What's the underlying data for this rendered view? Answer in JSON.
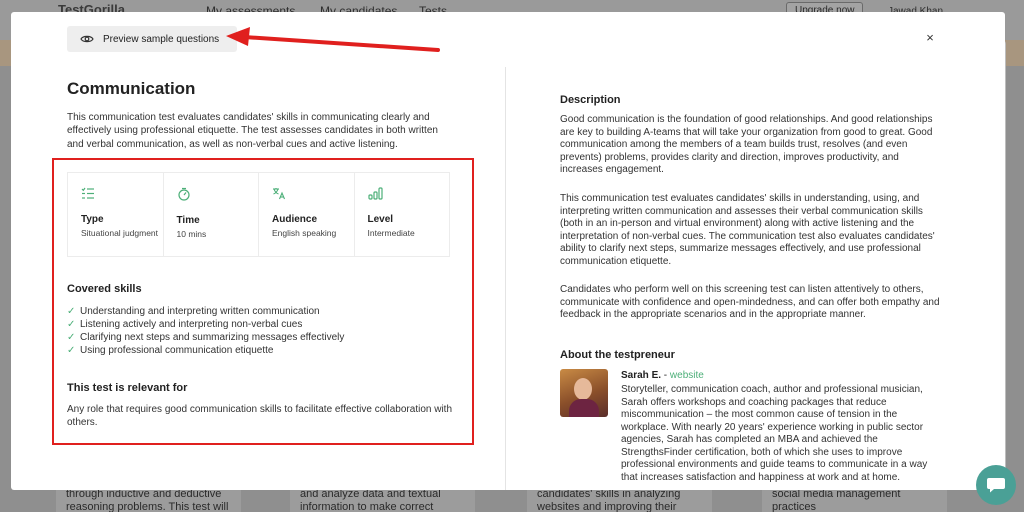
{
  "background": {
    "logo": "TestGorilla",
    "nav": [
      "My assessments",
      "My candidates",
      "Tests"
    ],
    "upgrade_label": "Upgrade now",
    "user_name": "Jawad Khan",
    "cards": [
      "through inductive and deductive\nreasoning problems. This test will",
      "and analyze data and textual\ninformation to make correct",
      "candidates' skills in analyzing\nwebsites and improving their ranking",
      "social media management practices\nand their ability to apply their"
    ]
  },
  "modal": {
    "preview_label": "Preview sample questions",
    "close_label": "×",
    "title": "Communication",
    "intro": "This communication test evaluates candidates' skills in communicating clearly and effectively using professional etiquette. The test assesses candidates in both written and verbal communication, as well as non-verbal cues and active listening.",
    "info": [
      {
        "icon": "list-icon",
        "label": "Type",
        "value": "Situational judgment"
      },
      {
        "icon": "stopwatch-icon",
        "label": "Time",
        "value": "10 mins"
      },
      {
        "icon": "translate-icon",
        "label": "Audience",
        "value": "English speaking"
      },
      {
        "icon": "bars-icon",
        "label": "Level",
        "value": "Intermediate"
      }
    ],
    "covered_skills_title": "Covered skills",
    "skills": [
      "Understanding and interpreting written communication",
      "Listening actively and interpreting non-verbal cues",
      "Clarifying next steps and summarizing messages effectively",
      "Using professional communication etiquette"
    ],
    "relevant_title": "This test is relevant for",
    "relevant_text": "Any role that requires good communication skills to facilitate effective collaboration with others.",
    "description_title": "Description",
    "description": [
      "Good communication is the foundation of good relationships. And good relationships are key to building A-teams that will take your organization from good to great. Good communication among the members of a team builds trust, resolves (and even prevents) problems, provides clarity and direction, improves productivity, and increases engagement.",
      "This communication test evaluates candidates' skills in understanding, using, and interpreting written communication and assesses their verbal communication skills (both in an in-person and virtual environment) along with active listening and the interpretation of non-verbal cues. The communication test also evaluates candidates' ability to clarify next steps, summarize messages effectively, and use professional communication etiquette.",
      "Candidates who perform well on this screening test can listen attentively to others, communicate with confidence and open-mindedness, and can offer both empathy and feedback in the appropriate scenarios and in the appropriate manner."
    ],
    "testpreneur_title": "About the testpreneur",
    "testpreneur_name": "Sarah E.",
    "testpreneur_sep": " - ",
    "testpreneur_link": "website",
    "testpreneur_bio": "Storyteller, communication coach, author and professional musician, Sarah offers workshops and coaching packages that reduce miscommunication – the most common cause of tension in the workplace. With nearly 20 years' experience working in public sector agencies, Sarah has completed an MBA and achieved the StrengthsFinder certification, both of which she uses to improve professional environments and guide teams to communicate in a way that increases satisfaction and happiness at work and at home."
  },
  "colors": {
    "accent_green": "#4caf78",
    "annotation_red": "#e0201e",
    "chat_teal": "#4aa096"
  }
}
